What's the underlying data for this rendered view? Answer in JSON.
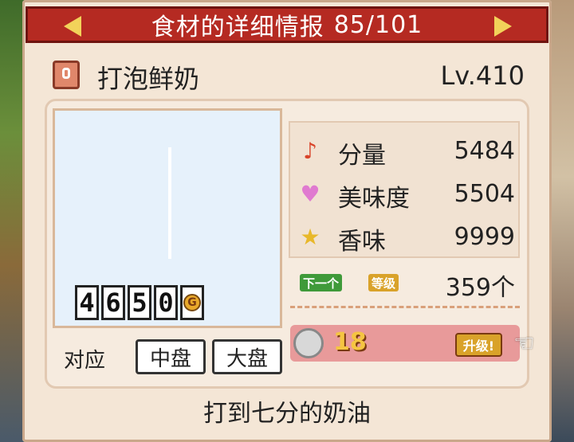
{
  "header": {
    "title": "食材的详细情报",
    "counter": "85/101"
  },
  "item": {
    "name": "打泡鲜奶",
    "level": "Lv.410",
    "price_digits": [
      "4",
      "6",
      "5",
      "0"
    ],
    "price_currency": "G"
  },
  "sizes": {
    "label": "对应",
    "options": [
      "中盘",
      "大盘"
    ]
  },
  "stats": [
    {
      "icon": "music-note-icon",
      "label": "分量",
      "value": "5484",
      "color": "#d9442a"
    },
    {
      "icon": "heart-icon",
      "label": "美味度",
      "value": "5504",
      "color": "#e07ad0"
    },
    {
      "icon": "star-icon",
      "label": "香味",
      "value": "9999",
      "color": "#e8b82a"
    }
  ],
  "next_level": {
    "tag_next": "下一个",
    "tag_level": "等级",
    "count": "359个"
  },
  "upgrade": {
    "cost": "18",
    "button": "升级!"
  },
  "description": "打到七分的奶油"
}
